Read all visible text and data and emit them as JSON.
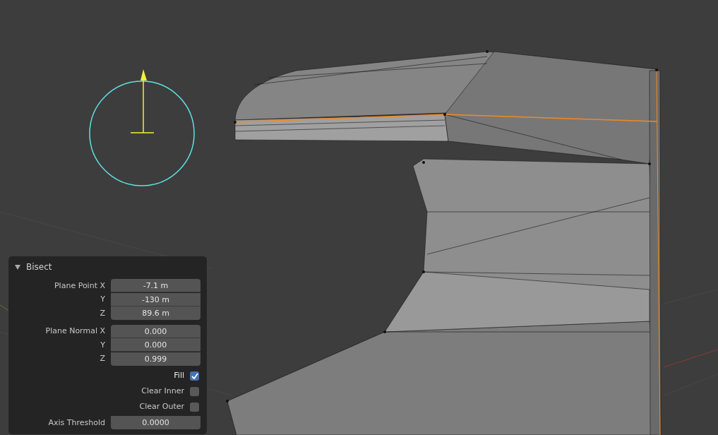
{
  "operator_panel": {
    "title": "Bisect",
    "expanded": true,
    "groups": [
      {
        "rows": [
          {
            "label": "Plane Point X",
            "value": "-7.1 m"
          },
          {
            "label": "Y",
            "value": "-130 m"
          },
          {
            "label": "Z",
            "value": "89.6 m"
          }
        ]
      },
      {
        "rows": [
          {
            "label": "Plane Normal X",
            "value": "0.000"
          },
          {
            "label": "Y",
            "value": "0.000"
          },
          {
            "label": "Z",
            "value": "0.999"
          }
        ]
      }
    ],
    "checkboxes": [
      {
        "label": "Fill",
        "checked": true
      },
      {
        "label": "Clear Inner",
        "checked": false
      },
      {
        "label": "Clear Outer",
        "checked": false
      }
    ],
    "axis_threshold": {
      "label": "Axis Threshold",
      "value": "0.0000"
    }
  }
}
